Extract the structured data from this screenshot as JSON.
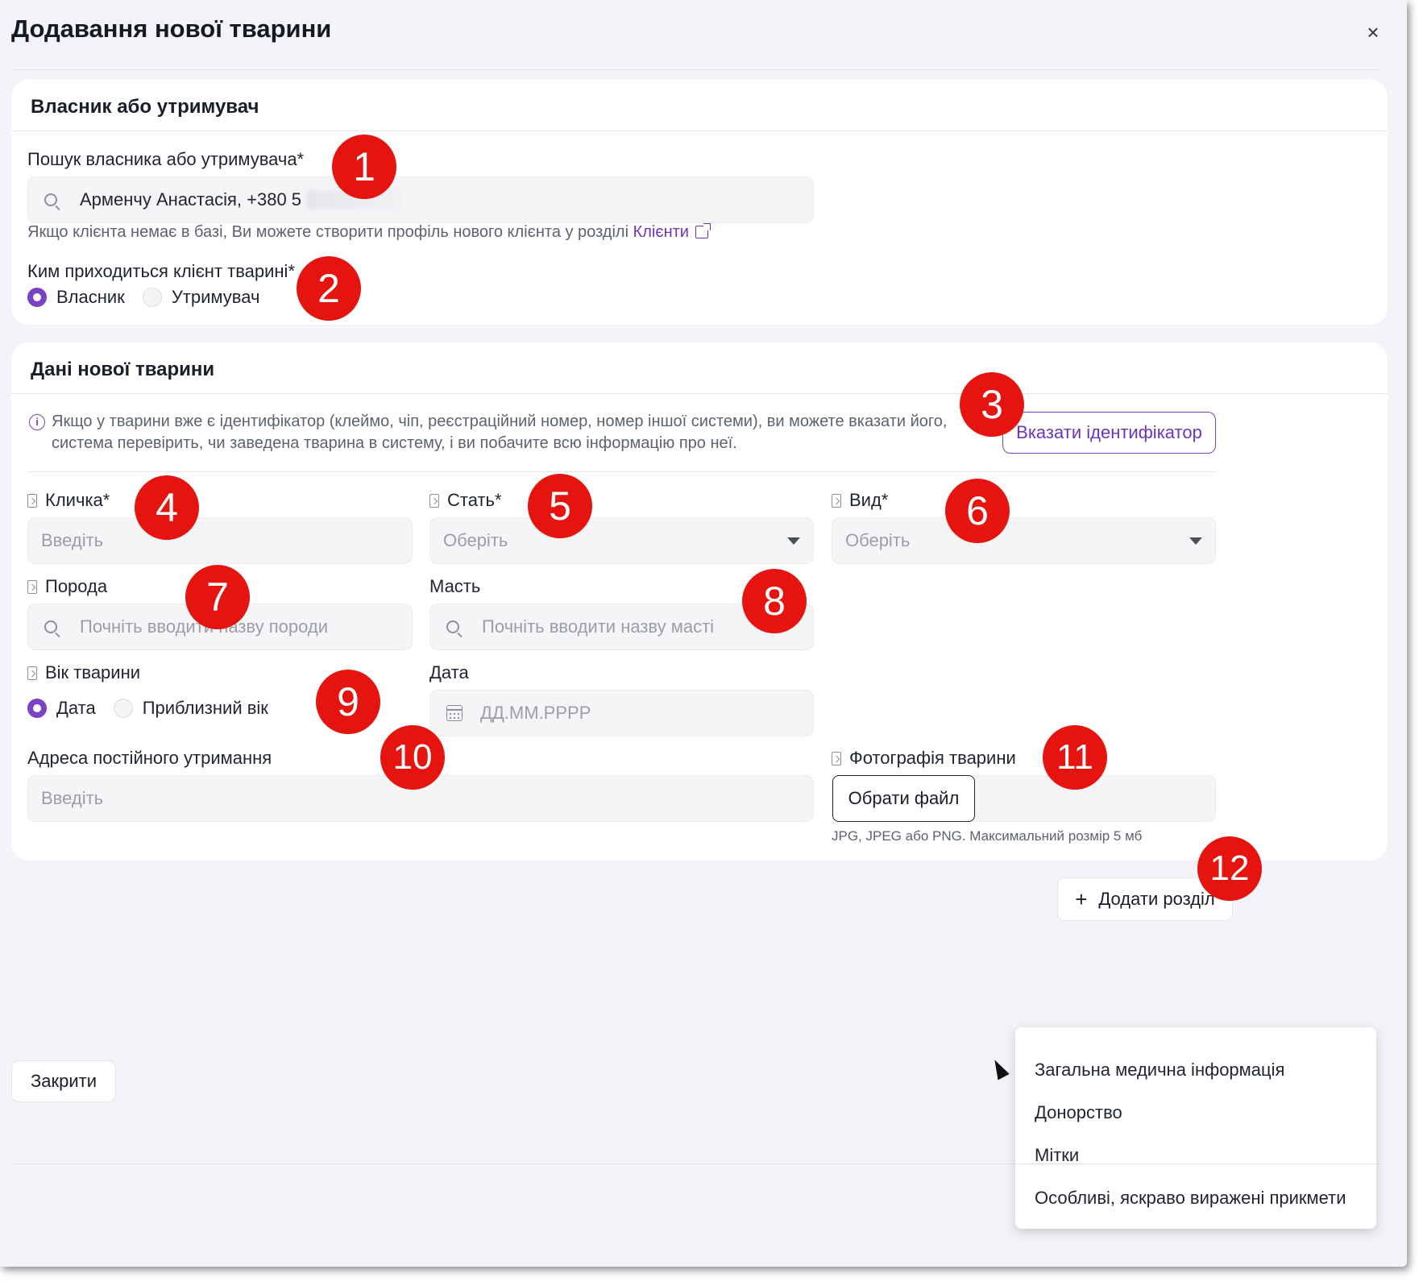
{
  "dialog": {
    "title": "Додавання нової тварини",
    "close_icon": "close-icon"
  },
  "owner": {
    "section_title": "Власник або утримувач",
    "search_label": "Пошук власника або утримувача*",
    "search_value": "Арменчу Анастасія, +380 5",
    "hint_text": "Якщо клієнта немає в базі, Ви можете створити профіль нового клієнта у розділі ",
    "hint_link": "Клієнти",
    "relation_label": "Ким приходиться клієнт тварині*",
    "relation_options": [
      "Власник",
      "Утримувач"
    ],
    "relation_selected": "Власник"
  },
  "animal": {
    "section_title": "Дані нової тварини",
    "info_line1": "Якщо у тварини вже є ідентифікатор (клеймо, чіп, реєстраційний номер, номер іншої системи), ви можете вказати його,",
    "info_line2": "система перевірить, чи заведена тварина в систему, і ви побачите всю інформацію про неї.",
    "identifier_button": "Вказати ідентифікатор",
    "name_label": "Кличка*",
    "name_placeholder": "Введіть",
    "sex_label": "Стать*",
    "sex_placeholder": "Оберіть",
    "species_label": "Вид*",
    "species_placeholder": "Оберіть",
    "breed_label": "Порода",
    "breed_placeholder": "Почніть вводити назву породи",
    "color_label": "Масть",
    "color_placeholder": "Почніть вводити назву масті",
    "age_label": "Вік тварини",
    "age_options": [
      "Дата",
      "Приблизний вік"
    ],
    "age_selected": "Дата",
    "date_label": "Дата",
    "date_placeholder": "ДД.ММ.РРРР",
    "address_label": "Адреса постійного утримання",
    "address_placeholder": "Введіть",
    "photo_label": "Фотографія тварини",
    "photo_button": "Обрати файл",
    "photo_hint": "JPG, JPEG або PNG. Максимальний розмір 5 мб"
  },
  "add_section": {
    "button_label": "Додати розділ",
    "menu_items": [
      "Загальна медична інформація",
      "Донорство",
      "Мітки",
      "Особливі, яскраво виражені прикмети"
    ]
  },
  "footer": {
    "close_button": "Закрити"
  },
  "markers": [
    "1",
    "2",
    "3",
    "4",
    "5",
    "6",
    "7",
    "8",
    "9",
    "10",
    "11",
    "12"
  ],
  "colors": {
    "accent": "#7a42c4",
    "marker": "#e5140f",
    "background": "#f3f3f9"
  }
}
